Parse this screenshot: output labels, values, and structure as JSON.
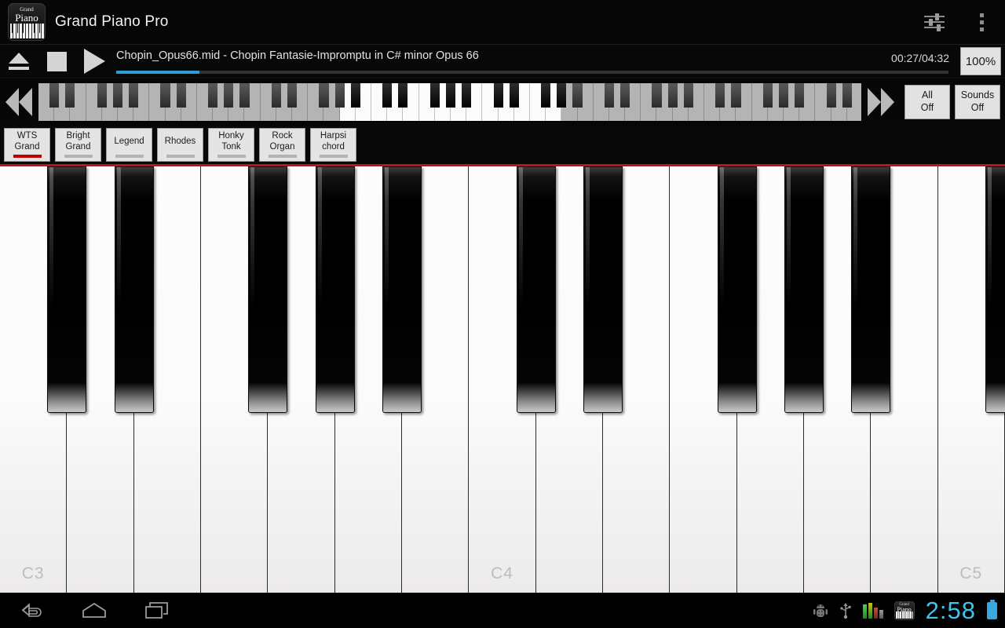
{
  "app": {
    "title": "Grand Piano Pro",
    "icon_name": "grand-piano-app-icon",
    "icon_text_top": "Grand",
    "icon_text_main": "Piano"
  },
  "titlebar": {
    "equalizer_icon": "sliders-icon",
    "overflow_icon": "overflow-menu-icon"
  },
  "transport": {
    "eject_icon": "eject-icon",
    "stop_icon": "stop-icon",
    "play_icon": "play-icon",
    "track_title": "Chopin_Opus66.mid - Chopin Fantasie-Impromptu in C# minor Opus 66",
    "time": "00:27/04:32",
    "tempo_label": "100%",
    "progress_percent": 10
  },
  "navstrip": {
    "prev_icon": "double-chevron-left-icon",
    "next_icon": "double-chevron-right-icon",
    "all_off_label_1": "All",
    "all_off_label_2": "Off",
    "sounds_off_label_1": "Sounds",
    "sounds_off_label_2": "Off"
  },
  "presets": {
    "selected_index": 0,
    "items": [
      {
        "line1": "WTS",
        "line2": "Grand"
      },
      {
        "line1": "Bright",
        "line2": "Grand"
      },
      {
        "line1": "Legend",
        "line2": ""
      },
      {
        "line1": "Rhodes",
        "line2": ""
      },
      {
        "line1": "Honky",
        "line2": "Tonk"
      },
      {
        "line1": "Rock",
        "line2": "Organ"
      },
      {
        "line1": "Harpsi",
        "line2": "chord"
      }
    ]
  },
  "keyboard": {
    "white_key_count": 15,
    "octave_labels": [
      {
        "key_index": 0,
        "label": "C3"
      },
      {
        "key_index": 7,
        "label": "C4"
      },
      {
        "key_index": 14,
        "label": "C5"
      }
    ],
    "black_key_after_white_index": [
      0,
      1,
      3,
      4,
      5,
      7,
      8,
      10,
      11,
      12,
      14
    ],
    "accent_line_color": "#c41010"
  },
  "statusbar": {
    "back_icon": "back-icon",
    "home_icon": "home-icon",
    "recents_icon": "recent-apps-icon",
    "adb_icon": "android-debug-icon",
    "usb_icon": "usb-icon",
    "meter_icon": "audio-level-meter-icon",
    "app_tray_icon": "grand-piano-tray-icon",
    "clock": "2:58",
    "battery_icon": "battery-icon",
    "clock_color": "#39c6f2"
  }
}
